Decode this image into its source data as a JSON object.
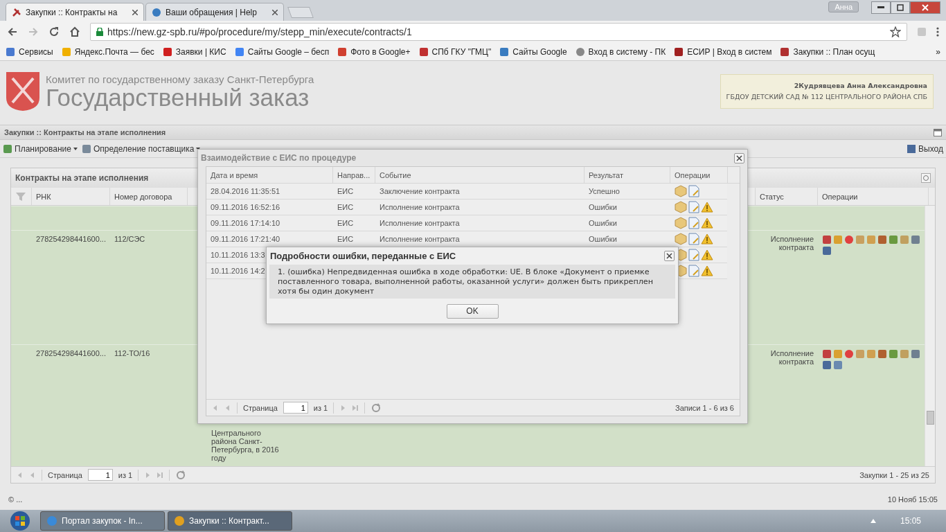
{
  "browser": {
    "tabs": [
      {
        "title": "Закупки :: Контракты на",
        "selected": true
      },
      {
        "title": "Ваши обращения | Help",
        "selected": false
      }
    ],
    "profile": "Анна",
    "url": "https://new.gz-spb.ru/#po/procedure/my/stepp_min/execute/contracts/1",
    "bookmarks": [
      "Сервисы",
      "Яндекс.Почта — бес",
      "Заявки | КИС",
      "Сайты Google – бесп",
      "Фото в Google+",
      "СПб ГКУ \"ГМЦ\"",
      "Сайты Google",
      "Вход в систему - ПК",
      "ЕСИР | Вход в систем",
      "Закупки :: План осущ"
    ],
    "more": "»"
  },
  "site": {
    "org": "Комитет по государственному заказу Санкт-Петербурга",
    "title": "Государственный заказ",
    "user": {
      "name": "2Кудрявцева Анна Александровна",
      "org": "ГБДОУ ДЕТСКИЙ САД № 112 ЦЕНТРАЛЬНОГО РАЙОНА СПБ"
    }
  },
  "panel": {
    "title": "Закупки :: Контракты на этапе исполнения"
  },
  "menu": [
    {
      "label": "Планирование",
      "dropdown": true
    },
    {
      "label": "Определение поставщика",
      "dropdown": true
    }
  ],
  "exit": "Выход",
  "grid": {
    "title": "Контракты на этапе исполнения",
    "columns": [
      "РНК",
      "Номер договора",
      "Статус",
      "Операции"
    ],
    "rows": [
      {
        "rnk": "278254298441600...",
        "number": "112/СЭС",
        "status": "Исполнение контракта"
      },
      {
        "rnk": "278254298441600...",
        "number": "112-ТО/16",
        "status": "Исполнение контракта",
        "description": "Центрального района Санкт-Петербурга, в 2016 году"
      }
    ],
    "pager": {
      "page_label": "Страница",
      "page": "1",
      "of": "из 1",
      "summary": "Закупки 1 - 25 из 25"
    }
  },
  "eis_dialog": {
    "title": "Взаимодействие с ЕИС по процедуре",
    "columns": [
      "Дата и время",
      "Направ...",
      "Событие",
      "Результат",
      "Операции"
    ],
    "rows": [
      {
        "date": "28.04.2016 11:35:51",
        "direction": "ЕИС",
        "event": "Заключение контракта",
        "result": "Успешно",
        "warning": false
      },
      {
        "date": "09.11.2016 16:52:16",
        "direction": "ЕИС",
        "event": "Исполнение контракта",
        "result": "Ошибки",
        "warning": true
      },
      {
        "date": "09.11.2016 17:14:10",
        "direction": "ЕИС",
        "event": "Исполнение контракта",
        "result": "Ошибки",
        "warning": true
      },
      {
        "date": "09.11.2016 17:21:40",
        "direction": "ЕИС",
        "event": "Исполнение контракта",
        "result": "Ошибки",
        "warning": true
      },
      {
        "date": "10.11.2016 13:3",
        "warning": true
      },
      {
        "date": "10.11.2016 14:2",
        "warning": true
      }
    ],
    "pager": {
      "page_label": "Страница",
      "page": "1",
      "of": "из 1",
      "summary": "Записи 1 - 6 из 6"
    }
  },
  "error_dialog": {
    "title": "Подробности ошибки, переданные с ЕИС",
    "message": "1. (ошибка) Непредвиденная ошибка в ходе обработки: UE. В блоке «Документ о приемке поставленного товара, выполненной работы, оказанной услуги» должен быть прикреплен хотя бы один документ",
    "button": "OK"
  },
  "status_bar": {
    "left": "© ...",
    "right": "10 Нояб 15:05"
  },
  "taskbar": {
    "items": [
      {
        "label": "Портал закупок - In...",
        "selected": false
      },
      {
        "label": "Закупки :: Контракт...",
        "selected": true
      }
    ],
    "clock": "15:05"
  }
}
